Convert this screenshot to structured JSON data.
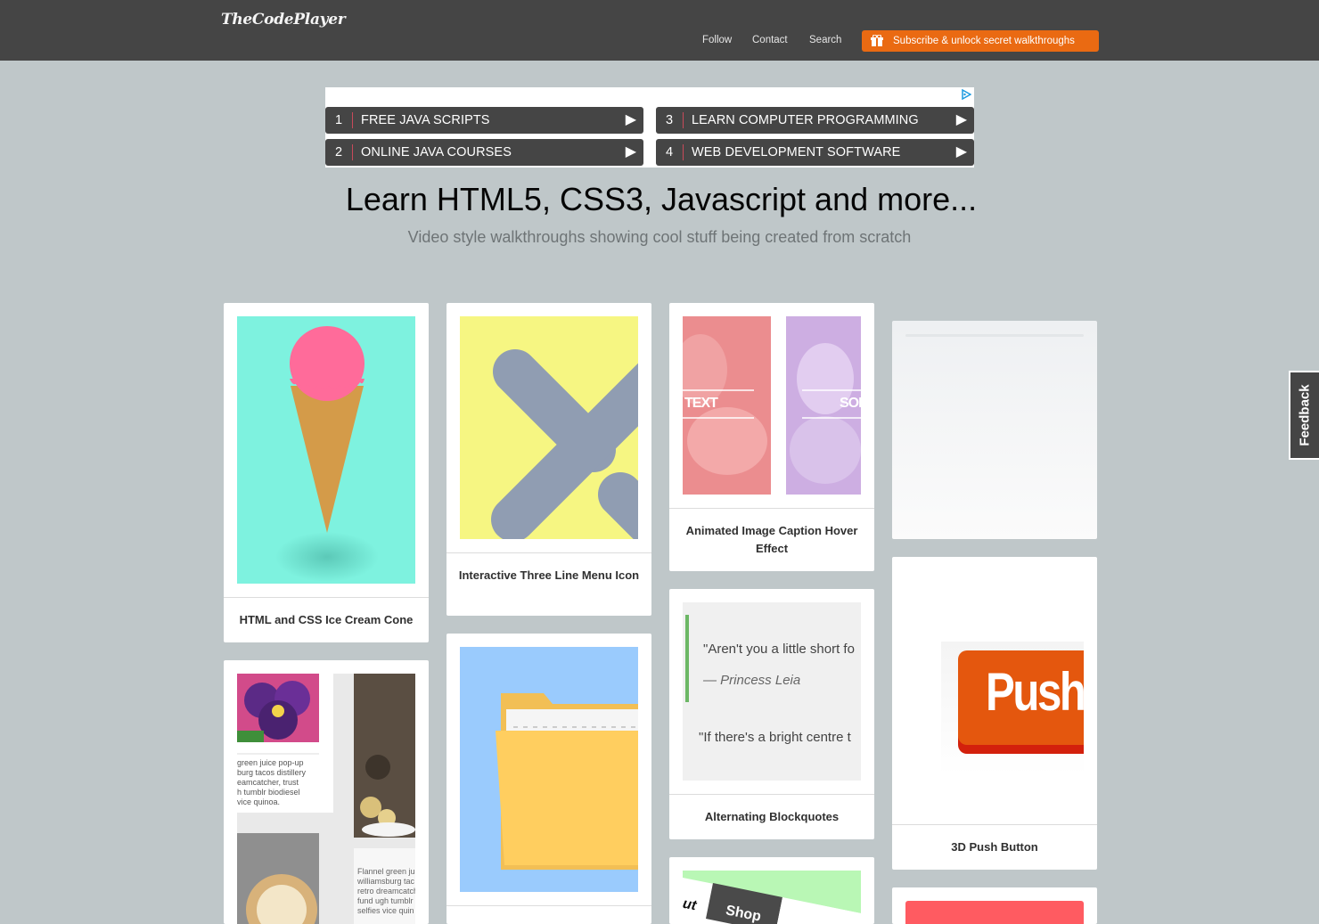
{
  "header": {
    "logo": "TheCodePlayer",
    "nav": [
      "Follow",
      "Contact",
      "Search"
    ],
    "subscribe_label": "Subscribe & unlock secret walkthroughs"
  },
  "ad": {
    "items": [
      {
        "num": "1",
        "label": "FREE JAVA SCRIPTS"
      },
      {
        "num": "3",
        "label": "LEARN COMPUTER PROGRAMMING"
      },
      {
        "num": "2",
        "label": "ONLINE JAVA COURSES"
      },
      {
        "num": "4",
        "label": "WEB DEVELOPMENT SOFTWARE"
      }
    ],
    "arrow": "▶"
  },
  "hero": {
    "title": "Learn HTML5, CSS3, Javascript and more...",
    "subtitle": "Video style walkthroughs showing cool stuff being created from scratch"
  },
  "cards": {
    "ice_cream": "HTML and CSS Ice Cream Cone",
    "menu_icon": "Interactive Three Line Menu Icon",
    "caption": "Animated Image Caption Hover Effect",
    "blockquotes": "Alternating Blockquotes",
    "push": "3D Push Button"
  },
  "thumb_text": {
    "caption_text": "TEXT",
    "caption_text2": "SOI",
    "quote1": "\"Aren't you a little short fo",
    "quote_author": "— Princess Leia",
    "quote2": "\"If there's a bright centre t",
    "push": "Push",
    "shop": "Shop",
    "shop_prefix": "ut",
    "blog1_line1": "green juice pop-up",
    "blog1_line2": "burg tacos distillery",
    "blog1_line3": "eamcatcher, trust",
    "blog1_line4": "h tumblr biodiesel",
    "blog1_line5": "vice quinoa.",
    "blog2_line1": "Flannel green jui",
    "blog2_line2": "williamsburg tac",
    "blog2_line3": "retro dreamcatch",
    "blog2_line4": "fund ugh tumblr",
    "blog2_line5": "selfies vice quin"
  },
  "feedback_label": "Feedback",
  "colors": {
    "header": "#454545",
    "subscribe": "#ea6a12",
    "page_bg": "#bfc7c9"
  }
}
